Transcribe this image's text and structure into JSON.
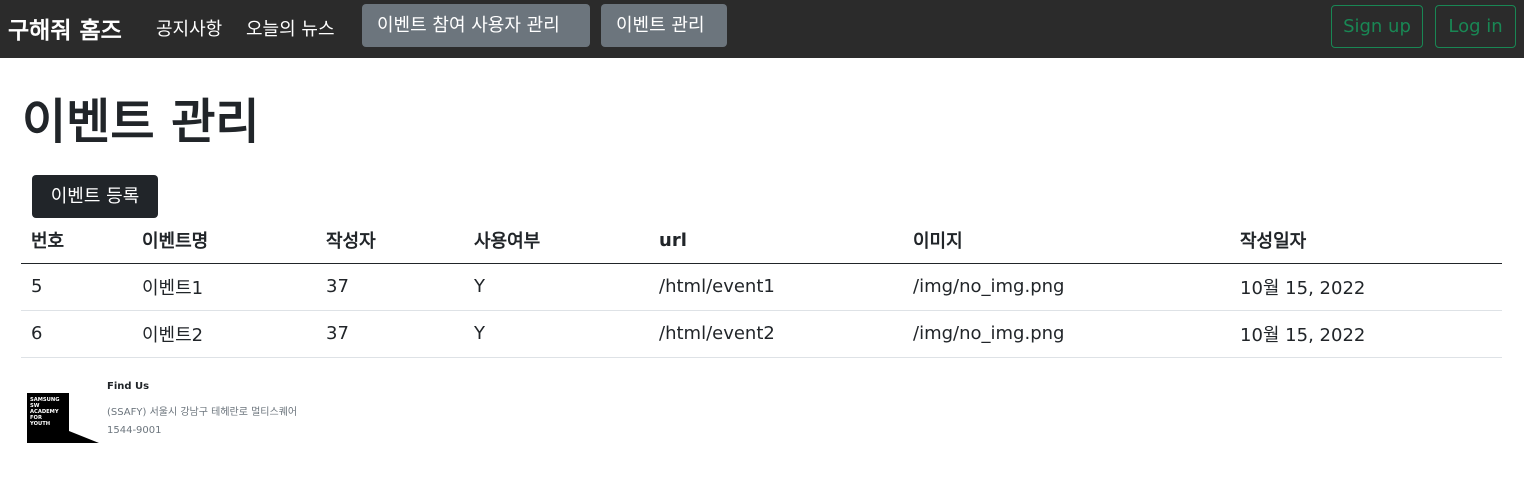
{
  "navbar": {
    "brand": "구해줘 홈즈",
    "links": [
      "공지사항",
      "오늘의 뉴스"
    ],
    "buttons": [
      "이벤트 참여 사용자 관리",
      "이벤트 관리"
    ],
    "signup": "Sign up",
    "login": "Log in"
  },
  "main": {
    "title": "이벤트 관리",
    "register_button": "이벤트 등록",
    "table": {
      "headers": [
        "번호",
        "이벤트명",
        "작성자",
        "사용여부",
        "url",
        "이미지",
        "작성일자"
      ],
      "rows": [
        [
          "5",
          "이벤트1",
          "37",
          "Y",
          "/html/event1",
          "/img/no_img.png",
          "10월 15, 2022"
        ],
        [
          "6",
          "이벤트2",
          "37",
          "Y",
          "/html/event2",
          "/img/no_img.png",
          "10월 15, 2022"
        ]
      ]
    }
  },
  "footer": {
    "logo_text": [
      "SAMSUNG",
      "SW",
      "ACADEMY",
      "FOR",
      "YOUTH"
    ],
    "find_us": "Find Us",
    "address": "(SSAFY) 서울시 강남구 테헤란로 멀티스퀘어",
    "phone": "1544-9001"
  },
  "colors": {
    "navbar_bg": "#2b2b2b",
    "secondary_button": "#6c757d",
    "success_outline": "#198754",
    "dark_button": "#212529"
  }
}
